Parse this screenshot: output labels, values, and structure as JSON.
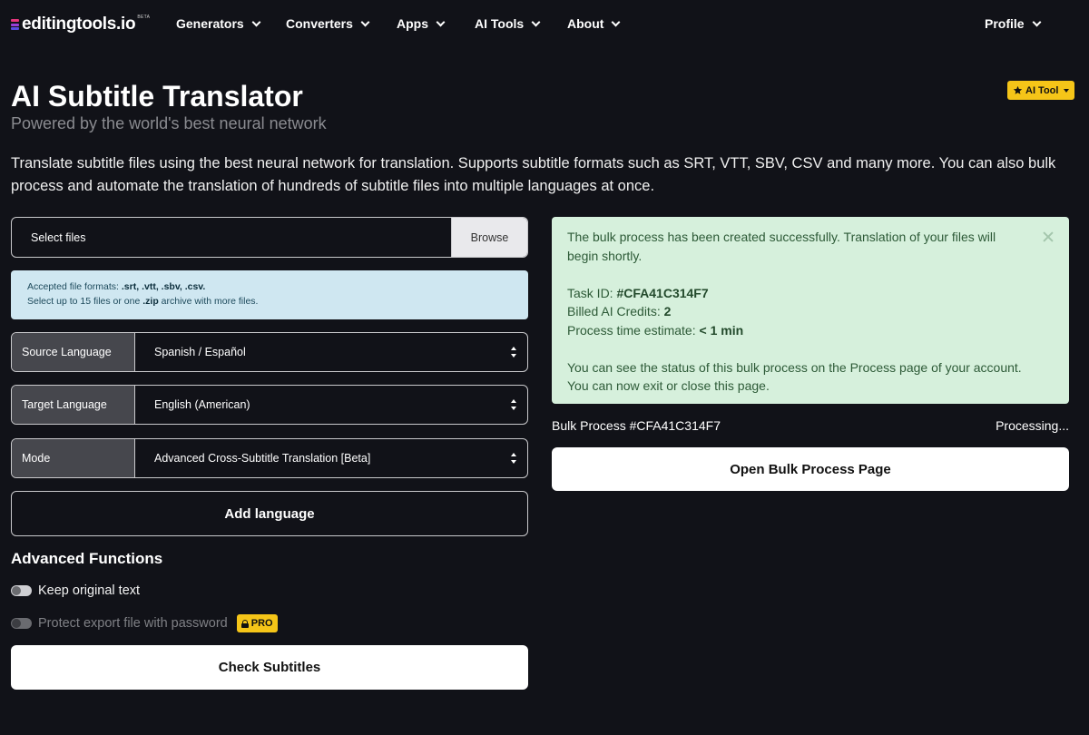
{
  "nav": {
    "logo_text": "editingtools.io",
    "logo_beta": "BETA",
    "items": [
      {
        "label": "Generators"
      },
      {
        "label": "Converters"
      },
      {
        "label": "Apps"
      },
      {
        "label": "AI Tools"
      },
      {
        "label": "About"
      }
    ],
    "profile_label": "Profile"
  },
  "header": {
    "title": "AI Subtitle Translator",
    "subtitle": "Powered by the world's best neural network",
    "badge": "AI Tool",
    "description": "Translate subtitle files using the best neural network for translation. Supports subtitle formats such as SRT, VTT, SBV, CSV and many more. You can also bulk process and automate the translation of hundreds of subtitle files into multiple languages at once."
  },
  "form": {
    "file_label": "Select files",
    "browse_label": "Browse",
    "info_accepted_prefix": "Accepted file formats: ",
    "info_formats": ".srt, .vtt, .sbv, .csv.",
    "info_select_prefix": "Select up to 15 files or one ",
    "info_zip": ".zip",
    "info_select_suffix": " archive with more files.",
    "source_label": "Source Language",
    "source_value": "Spanish / Español",
    "target_label": "Target Language",
    "target_value": "English (American)",
    "mode_label": "Mode",
    "mode_value": "Advanced Cross-Subtitle Translation [Beta]",
    "add_language_label": "Add language",
    "advanced_title": "Advanced Functions",
    "keep_original_label": "Keep original text",
    "protect_label": "Protect export file with password",
    "pro_badge": "PRO",
    "check_button": "Check Subtitles"
  },
  "result": {
    "message": "The bulk process has been created successfully. Translation of your files will begin shortly.",
    "task_id_label": "Task ID: ",
    "task_id": "#CFA41C314F7",
    "credits_label": "Billed AI Credits: ",
    "credits": "2",
    "time_label": "Process time estimate: ",
    "time": "< 1 min",
    "status_note": "You can see the status of this bulk process on the Process page of your account.",
    "exit_note": "You can now exit or close this page.",
    "bulk_label": "Bulk Process #CFA41C314F7",
    "bulk_status": "Processing...",
    "open_button": "Open Bulk Process Page"
  }
}
